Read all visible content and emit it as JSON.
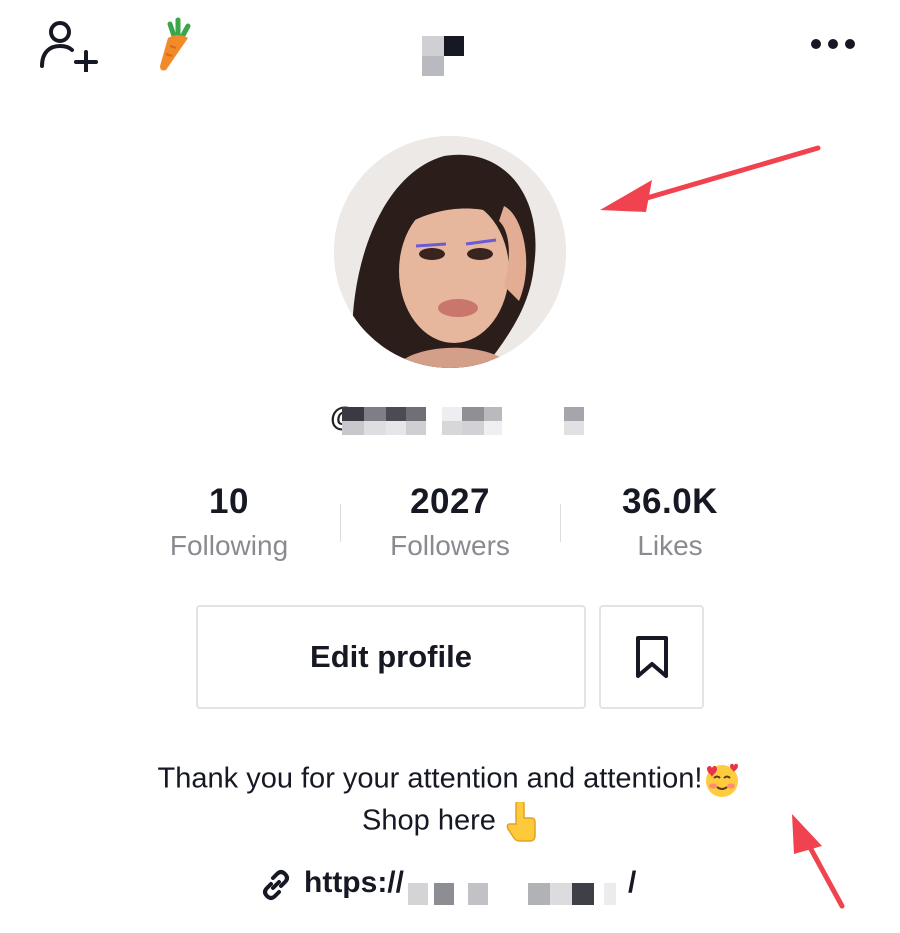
{
  "header": {
    "add_user_icon": "add-user-icon",
    "badge_icon": "carrot-icon",
    "more_icon": "more-options-icon"
  },
  "profile": {
    "at": "@",
    "stats": [
      {
        "value": "10",
        "label": "Following"
      },
      {
        "value": "2027",
        "label": "Followers"
      },
      {
        "value": "36.0K",
        "label": "Likes"
      }
    ],
    "edit_label": "Edit profile",
    "bookmark_icon": "bookmark-icon",
    "bio_line1": "Thank you for your attention and attention!",
    "bio_line1_emoji": "smiling-face-with-hearts",
    "bio_line2": "Shop here",
    "bio_line2_emoji": "pointing-down",
    "link_prefix": "https://",
    "link_suffix": "/"
  },
  "colors": {
    "text": "#161823",
    "secondary": "#8a8b91",
    "border": "#e3e3e4",
    "annotation_arrow": "#f0434f"
  }
}
